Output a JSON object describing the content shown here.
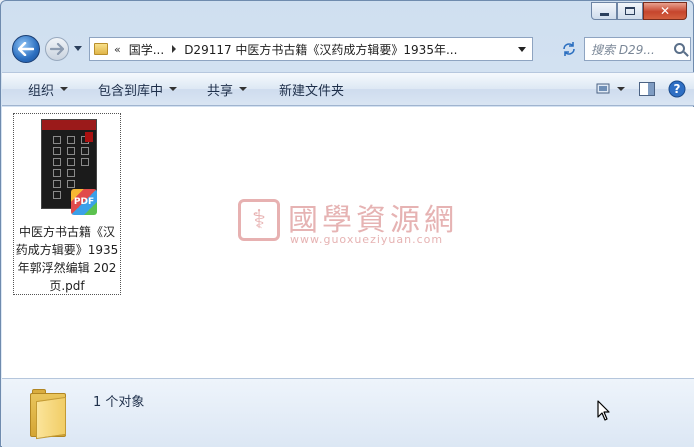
{
  "window": {
    "caption": {
      "minimize_icon": "minimize-icon",
      "maximize_icon": "maximize-icon",
      "close_icon": "close-icon"
    }
  },
  "nav": {
    "back_icon": "back-arrow-icon",
    "forward_icon": "forward-arrow-icon",
    "address": {
      "overflow": "«",
      "segments": [
        "国学...",
        "D29117 中医方书古籍《汉药成方辑要》1935年..."
      ]
    },
    "search_placeholder": "搜索 D29..."
  },
  "toolbar": {
    "organize": "组织",
    "include_library": "包含到库中",
    "share": "共享",
    "new_folder": "新建文件夹"
  },
  "files": [
    {
      "name": "中医方书古籍《汉药成方辑要》1935年郭浮然编辑 202页.pdf",
      "badge": "PDF"
    }
  ],
  "watermark": {
    "chinese": "國學資源網",
    "url": "www.guoxueziyuan.com"
  },
  "details": {
    "count_text": "1 个对象"
  },
  "colors": {
    "accent": "#2c6fc0",
    "window_frame": "#cfdff0",
    "close_button": "#c6452d"
  }
}
